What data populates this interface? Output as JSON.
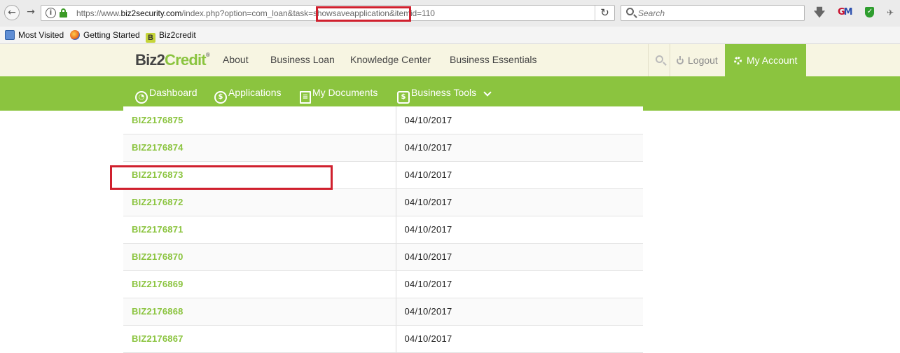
{
  "browser": {
    "url_prefix": "https://www.",
    "url_host": "biz2security.com",
    "url_rest": "/index.php?option=com_loan&task=showsaveapplication&itemid=110",
    "search_placeholder": "Search",
    "back_icon": "back-arrow-icon",
    "forward_icon": "forward-arrow-icon",
    "reload_icon": "reload-icon"
  },
  "bookmarks": [
    {
      "label": "Most Visited",
      "icon": "most-visited-icon"
    },
    {
      "label": "Getting Started",
      "icon": "firefox-icon"
    },
    {
      "label": "Biz2credit",
      "icon": "biz2credit-favicon"
    }
  ],
  "site": {
    "logo_part1": "Biz2",
    "logo_part2": "Credit",
    "logo_mark": "®",
    "top_nav": [
      "About",
      "Business Loan",
      "Knowledge Center",
      "Business Essentials"
    ],
    "logout": "Logout",
    "my_account": "My Account",
    "brand_green": "#8bc43f",
    "header_bg": "#f7f5e2"
  },
  "menu": [
    "Dashboard",
    "Applications",
    "My Documents",
    "Business Tools"
  ],
  "applications": [
    {
      "id": "BIZ2176875",
      "date": "04/10/2017"
    },
    {
      "id": "BIZ2176874",
      "date": "04/10/2017"
    },
    {
      "id": "BIZ2176873",
      "date": "04/10/2017"
    },
    {
      "id": "BIZ2176872",
      "date": "04/10/2017"
    },
    {
      "id": "BIZ2176871",
      "date": "04/10/2017"
    },
    {
      "id": "BIZ2176870",
      "date": "04/10/2017"
    },
    {
      "id": "BIZ2176869",
      "date": "04/10/2017"
    },
    {
      "id": "BIZ2176868",
      "date": "04/10/2017"
    },
    {
      "id": "BIZ2176867",
      "date": "04/10/2017"
    }
  ],
  "annotation_color": "#d0202e"
}
